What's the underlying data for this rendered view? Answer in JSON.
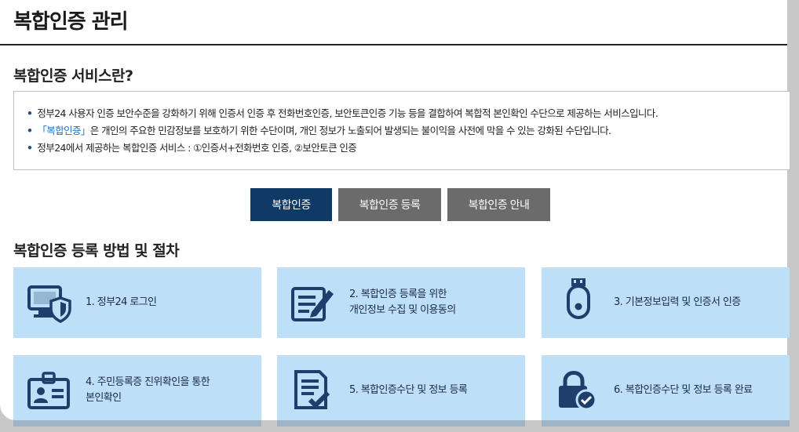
{
  "page": {
    "title": "복합인증 관리"
  },
  "intro": {
    "heading": "복합인증 서비스란?",
    "items": [
      {
        "pre": "정부24 사용자 인증 보안수준을 강화하기 위해 인증서 인증 후 전화번호인증, 보안토큰인증 기능 등을 결합하여 복합적 본인확인 수단으로 제공하는 서비스입니다.",
        "highlight": "",
        "post": ""
      },
      {
        "pre": "",
        "highlight": "「복합인증」",
        "post": "은 개인의 주요한 민감정보를 보호하기 위한 수단이며, 개인 정보가 노출되어 발생되는 불이익을 사전에 막을 수 있는 강화된 수단입니다."
      },
      {
        "pre": "정부24에서 제공하는 복합인증 서비스 : ①인증서+전화번호 인증, ②보안토큰 인증",
        "highlight": "",
        "post": ""
      }
    ],
    "bullet": "•"
  },
  "tabs": [
    {
      "label": "복합인증",
      "active": true
    },
    {
      "label": "복합인증 등록",
      "active": false
    },
    {
      "label": "복합인증 안내",
      "active": false
    }
  ],
  "procedure": {
    "heading": "복합인증 등록 방법 및 절차",
    "steps": [
      {
        "line1": "1. 정부24 로그인",
        "line2": "",
        "icon": "monitor-shield-icon"
      },
      {
        "line1": "2. 복합인증 등록을 위한",
        "line2": "개인정보 수집 및 이용동의",
        "icon": "form-pencil-icon"
      },
      {
        "line1": "3. 기본정보입력 및 인증서 인증",
        "line2": "",
        "icon": "usb-token-icon"
      },
      {
        "line1": "4. 주민등록증 진위확인을 통한",
        "line2": "본인확인",
        "icon": "id-card-icon"
      },
      {
        "line1": "5. 복합인증수단 및 정보 등록",
        "line2": "",
        "icon": "document-check-icon"
      },
      {
        "line1": "6. 복합인증수단 및 정보 등록 완료",
        "line2": "",
        "icon": "lock-check-icon"
      }
    ]
  },
  "colors": {
    "accent": "#0f3a66",
    "tab_inactive": "#6b6b6b",
    "step_bg": "#bddff7",
    "icon": "#1f3e6b",
    "highlight": "#1a73c9"
  }
}
